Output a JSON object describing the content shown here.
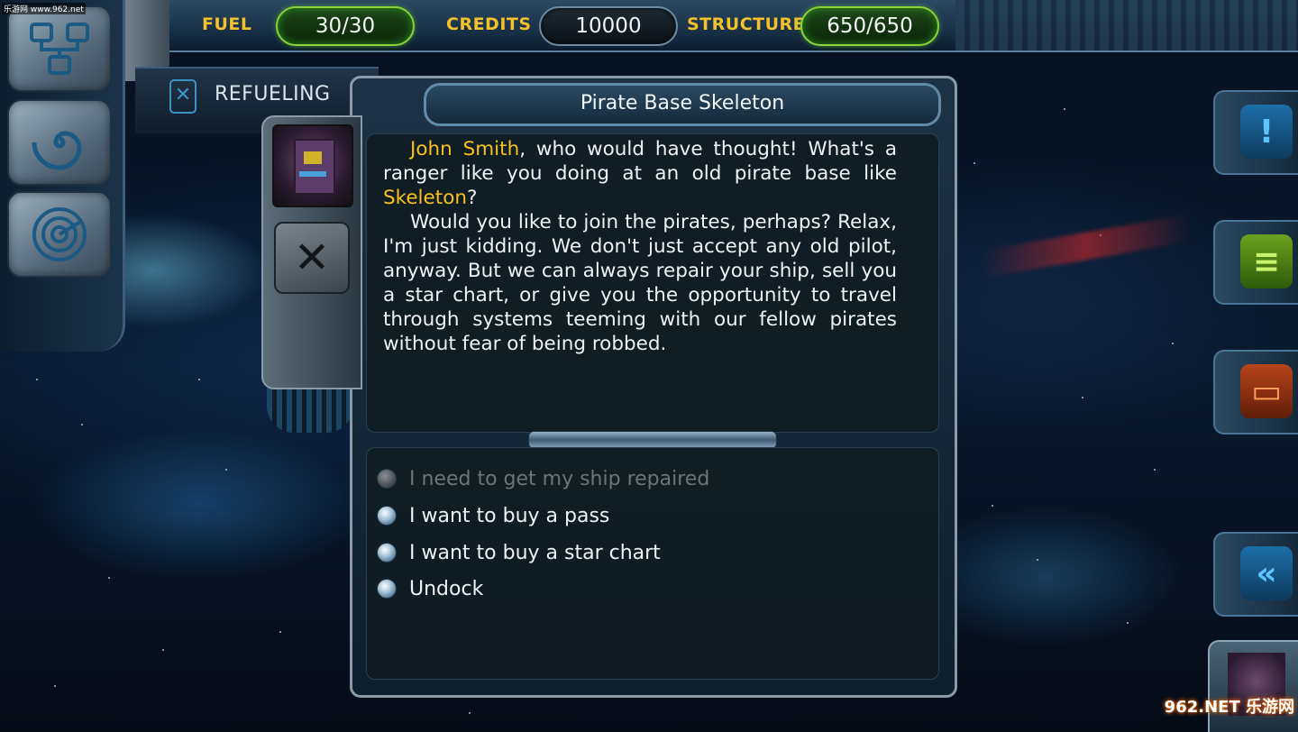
{
  "hud": {
    "fuel": {
      "label": "FUEL",
      "value": "30/30"
    },
    "credits": {
      "label": "CREDITS",
      "value": "10000"
    },
    "structure": {
      "label": "STRUCTURE",
      "value": "650/650"
    }
  },
  "location_tab": {
    "label": "REFUELING",
    "icon": "fuel-canister-icon"
  },
  "left_menu": [
    {
      "name": "network-map-icon"
    },
    {
      "name": "vortex-icon"
    },
    {
      "name": "radar-icon"
    }
  ],
  "right_menu": [
    {
      "name": "alert-icon",
      "color": "#2ea0e6"
    },
    {
      "name": "log-icon",
      "color": "#8ccf2e"
    },
    {
      "name": "chat-icon",
      "color": "#e25a22"
    },
    {
      "name": "back-arrows-icon",
      "color": "#2ea0e6"
    }
  ],
  "dialog": {
    "title": "Pirate Base Skeleton",
    "speaker_name": "John Smith",
    "para1_after_name": ", who would have thought! What's a ranger like you doing at an old pirate base like ",
    "base_name": "Skeleton",
    "para1_end": "?",
    "para2": "Would you like to join the pirates, perhaps? Relax, I'm just kidding. We don't just accept any old pilot, anyway. But we can always repair your ship, sell you a star chart, or give you the opportunity to travel through systems teeming with our fellow pirates without fear of being robbed.",
    "choices": [
      {
        "label": "I need to get my ship repaired",
        "enabled": false
      },
      {
        "label": "I want to buy a pass",
        "enabled": true
      },
      {
        "label": "I want to buy a star chart",
        "enabled": true
      },
      {
        "label": "Undock",
        "enabled": true
      }
    ]
  },
  "watermarks": {
    "top_left": "乐游网 www.962.net",
    "bottom_right": "962.NET 乐游网"
  },
  "colors": {
    "highlight": "#f7c11b",
    "hud_label": "#f3c12b",
    "hud_green": "#8bd13a"
  }
}
